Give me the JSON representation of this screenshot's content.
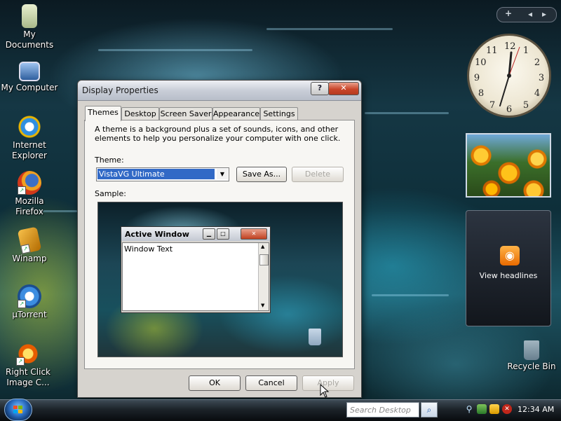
{
  "desktop": {
    "icons": [
      {
        "label": "My Documents"
      },
      {
        "label": "My Computer"
      },
      {
        "label": "Internet Explorer"
      },
      {
        "label": "Mozilla Firefox"
      },
      {
        "label": "Winamp"
      },
      {
        "label": "µTorrent"
      },
      {
        "label": "Right Click Image C..."
      }
    ],
    "recycle_bin": "Recycle Bin"
  },
  "dialog": {
    "title": "Display Properties",
    "help_glyph": "?",
    "close_glyph": "✕",
    "tabs": [
      {
        "label": "Themes",
        "active": true
      },
      {
        "label": "Desktop"
      },
      {
        "label": "Screen Saver"
      },
      {
        "label": "Appearance"
      },
      {
        "label": "Settings"
      }
    ],
    "description": "A theme is a background plus a set of sounds, icons, and other elements to help you personalize your computer with one click.",
    "theme_label": "Theme:",
    "theme_value": "VistaVG Ultimate",
    "save_as_label": "Save As...",
    "delete_label": "Delete",
    "sample_label": "Sample:",
    "sample": {
      "window_title": "Active Window",
      "window_text": "Window Text"
    },
    "ok_label": "OK",
    "cancel_label": "Cancel",
    "apply_label": "Apply"
  },
  "sidebar": {
    "add_glyph": "+",
    "prev_glyph": "◂",
    "next_glyph": "▸",
    "clock_numbers": [
      "12",
      "1",
      "2",
      "3",
      "4",
      "5",
      "6",
      "7",
      "8",
      "9",
      "10",
      "11"
    ],
    "feed_text": "View headlines"
  },
  "taskbar": {
    "search_placeholder": "Search Desktop",
    "time": "12:34 AM"
  },
  "colors": {
    "selection": "#3169c6",
    "close_red": "#c9462a",
    "rss_orange": "#e86a00"
  }
}
